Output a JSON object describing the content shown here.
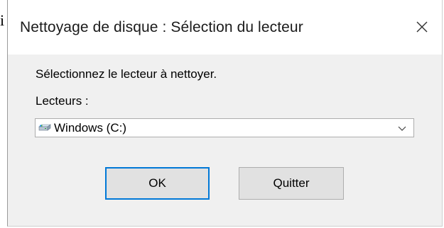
{
  "stray_glyph": "i",
  "window": {
    "title": "Nettoyage de disque : Sélection du lecteur",
    "close_glyph": "✕"
  },
  "content": {
    "prompt": "Sélectionnez le lecteur à nettoyer.",
    "drives_label": "Lecteurs :",
    "selected_drive": "Windows (C:)",
    "drive_icon": "drive-icon"
  },
  "buttons": {
    "ok_label": "OK",
    "quit_label": "Quitter"
  },
  "colors": {
    "focus_border": "#0078d7",
    "dialog_background": "#f0f0f0",
    "titlebar_background": "#ffffff",
    "button_background": "#e1e1e1"
  }
}
